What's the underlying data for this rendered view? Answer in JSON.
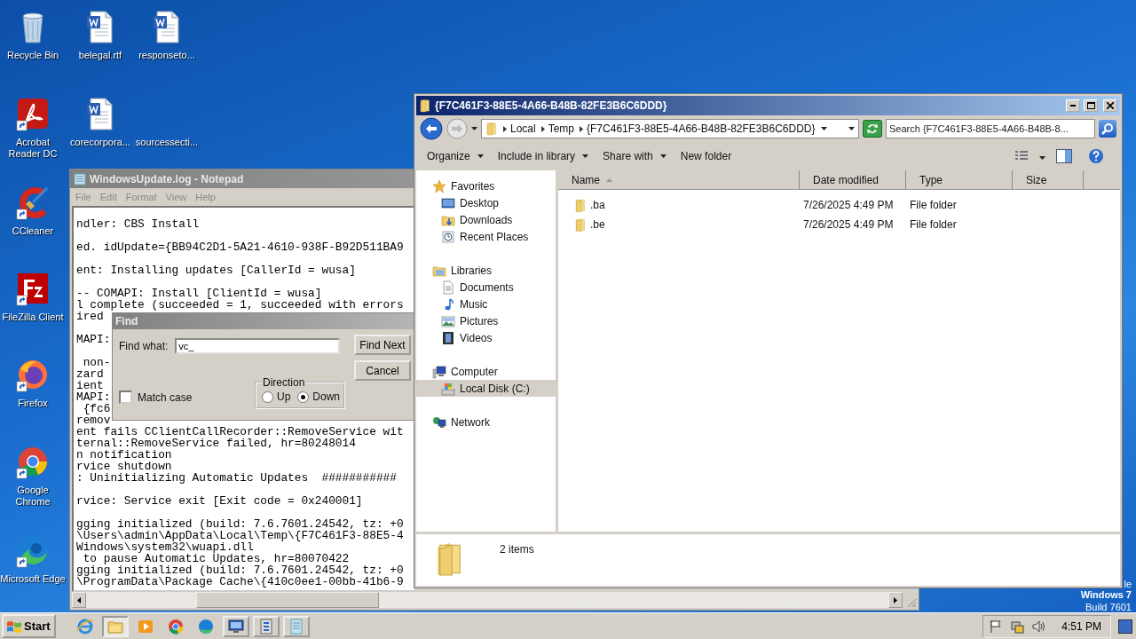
{
  "desktop": {
    "icons": [
      {
        "label": "Recycle Bin",
        "kind": "recycle",
        "shortcut": false
      },
      {
        "label": "belegal.rtf",
        "kind": "document",
        "shortcut": false
      },
      {
        "label": "responseto...",
        "kind": "document",
        "shortcut": false
      },
      {
        "label": "Acrobat Reader DC",
        "kind": "pdf",
        "shortcut": true
      },
      {
        "label": "corecorpora...",
        "kind": "document",
        "shortcut": false
      },
      {
        "label": "sourcessecti...",
        "kind": "blank",
        "shortcut": false
      },
      {
        "label": "CCleaner",
        "kind": "cleaner",
        "shortcut": true
      },
      {
        "label": "FileZilla Client",
        "kind": "ftp",
        "shortcut": true
      },
      {
        "label": "Firefox",
        "kind": "firefox",
        "shortcut": true
      },
      {
        "label": "Google Chrome",
        "kind": "chrome",
        "shortcut": true
      },
      {
        "label": "Microsoft Edge",
        "kind": "edge",
        "shortcut": true
      }
    ],
    "os_label": [
      "le",
      "Windows 7",
      "Build 7601"
    ]
  },
  "notepad": {
    "title": "WindowsUpdate.log - Notepad",
    "menu": [
      "File",
      "Edit",
      "Format",
      "View",
      "Help"
    ],
    "blocks": [
      [
        "ndler: CBS Install"
      ],
      [
        "ed. idUpdate={BB94C2D1-5A21-4610-938F-B92D511BA9"
      ],
      [
        "ent: Installing updates [CallerId = wusa]"
      ],
      [
        "-- COMAPI: Install [ClientId = wusa]",
        "l complete (succeeded = 1, succeeded with errors",
        "ired"
      ],
      [
        "MAPI:"
      ],
      [
        " non-",
        "zard",
        "ient",
        "MAPI:",
        " {fc6",
        "remov",
        "ent fails CClientCallRecorder::RemoveService wit",
        "ternal::RemoveService failed, hr=80248014",
        "n notification",
        "rvice shutdown",
        ": Uninitializing Automatic Updates  ###########"
      ],
      [
        "rvice: Service exit [Exit code = 0x240001]"
      ],
      [
        "gging initialized (build: 7.6.7601.24542, tz: +0",
        "\\Users\\admin\\AppData\\Local\\Temp\\{F7C461F3-88E5-4",
        "Windows\\system32\\wuapi.dll",
        " to pause Automatic Updates, hr=80070422",
        "gging initialized (build: 7.6.7601.24542, tz: +0",
        "\\ProgramData\\Package Cache\\{410c0ee1-00bb-41b6-9"
      ]
    ]
  },
  "find_dialog": {
    "title": "Find",
    "find_what_label": "Find what:",
    "find_what_value": "vc_",
    "buttons": [
      "Find Next",
      "Cancel"
    ],
    "match_case": {
      "label": "Match case",
      "checked": false
    },
    "direction": {
      "label": "Direction",
      "options": [
        {
          "label": "Up",
          "selected": false
        },
        {
          "label": "Down",
          "selected": true
        }
      ]
    }
  },
  "explorer": {
    "title": "{F7C461F3-88E5-4A66-B48B-82FE3B6C6DDD}",
    "breadcrumb": [
      "Local",
      "Temp",
      "{F7C461F3-88E5-4A66-B48B-82FE3B6C6DDD}"
    ],
    "search": {
      "placeholder": "Search {F7C461F3-88E5-4A66-B48B-8..."
    },
    "toolbar": [
      {
        "label": "Organize",
        "dropdown": true
      },
      {
        "label": "Include in library",
        "dropdown": true
      },
      {
        "label": "Share with",
        "dropdown": true
      },
      {
        "label": "New folder",
        "dropdown": false
      }
    ],
    "nav": [
      {
        "label": "Favorites",
        "kind": "star",
        "selected": false,
        "children": [
          {
            "label": "Desktop",
            "kind": "desktop",
            "selected": false
          },
          {
            "label": "Downloads",
            "kind": "downloads",
            "selected": false
          },
          {
            "label": "Recent Places",
            "kind": "recent",
            "selected": false
          }
        ]
      },
      {
        "label": "Libraries",
        "kind": "libraries",
        "selected": false,
        "children": [
          {
            "label": "Documents",
            "kind": "documents",
            "selected": false
          },
          {
            "label": "Music",
            "kind": "music",
            "selected": false
          },
          {
            "label": "Pictures",
            "kind": "pictures",
            "selected": false
          },
          {
            "label": "Videos",
            "kind": "videos",
            "selected": false
          }
        ]
      },
      {
        "label": "Computer",
        "kind": "computer",
        "selected": false,
        "children": [
          {
            "label": "Local Disk (C:)",
            "kind": "disk",
            "selected": true
          }
        ]
      },
      {
        "label": "Network",
        "kind": "network",
        "selected": false
      }
    ],
    "columns": [
      {
        "label": "Name",
        "sorted": true
      },
      {
        "label": "Date modified",
        "sorted": false
      },
      {
        "label": "Type",
        "sorted": false
      },
      {
        "label": "Size",
        "sorted": false
      }
    ],
    "files": [
      {
        "name": ".ba",
        "date": "7/26/2025 4:49 PM",
        "type": "File folder"
      },
      {
        "name": ".be",
        "date": "7/26/2025 4:49 PM",
        "type": "File folder"
      }
    ],
    "status": "2 items"
  },
  "taskbar": {
    "start": "Start",
    "apps": [
      {
        "kind": "ie",
        "window": false,
        "active": false
      },
      {
        "kind": "folder",
        "window": true,
        "active": true
      },
      {
        "kind": "media",
        "window": false,
        "active": false
      },
      {
        "kind": "chrome",
        "window": false,
        "active": false
      },
      {
        "kind": "edge",
        "window": false,
        "active": false
      },
      {
        "kind": "monitor",
        "window": true,
        "active": false
      },
      {
        "kind": "tool",
        "window": true,
        "active": false
      },
      {
        "kind": "notepad",
        "window": true,
        "active": false
      }
    ],
    "clock": "4:51 PM"
  }
}
